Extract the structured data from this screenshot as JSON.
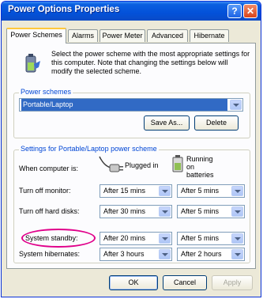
{
  "window": {
    "title": "Power Options Properties",
    "help_label": "?",
    "close_label": "✕"
  },
  "tabs": [
    "Power Schemes",
    "Alarms",
    "Power Meter",
    "Advanced",
    "Hibernate"
  ],
  "intro": "Select the power scheme with the most appropriate settings for this computer. Note that changing the settings below will modify the selected scheme.",
  "power_schemes": {
    "group_label": "Power schemes",
    "selected": "Portable/Laptop",
    "save_as_label": "Save As...",
    "delete_label": "Delete"
  },
  "settings": {
    "group_label": "Settings for Portable/Laptop power scheme",
    "when_label": "When computer is:",
    "plugged_in_label": "Plugged in",
    "batteries_label": "Running on batteries",
    "rows": [
      {
        "label": "Turn off monitor:",
        "plugged": "After 15 mins",
        "battery": "After 5 mins"
      },
      {
        "label": "Turn off hard disks:",
        "plugged": "After 30 mins",
        "battery": "After 5 mins"
      },
      {
        "label": "System standby:",
        "plugged": "After 20 mins",
        "battery": "After 5 mins"
      },
      {
        "label": "System hibernates:",
        "plugged": "After 3 hours",
        "battery": "After 2 hours"
      }
    ]
  },
  "footer": {
    "ok_label": "OK",
    "cancel_label": "Cancel",
    "apply_label": "Apply"
  },
  "colors": {
    "title_bar": "#0351d9",
    "group_label": "#0046d5",
    "highlight": "#e0008a"
  }
}
